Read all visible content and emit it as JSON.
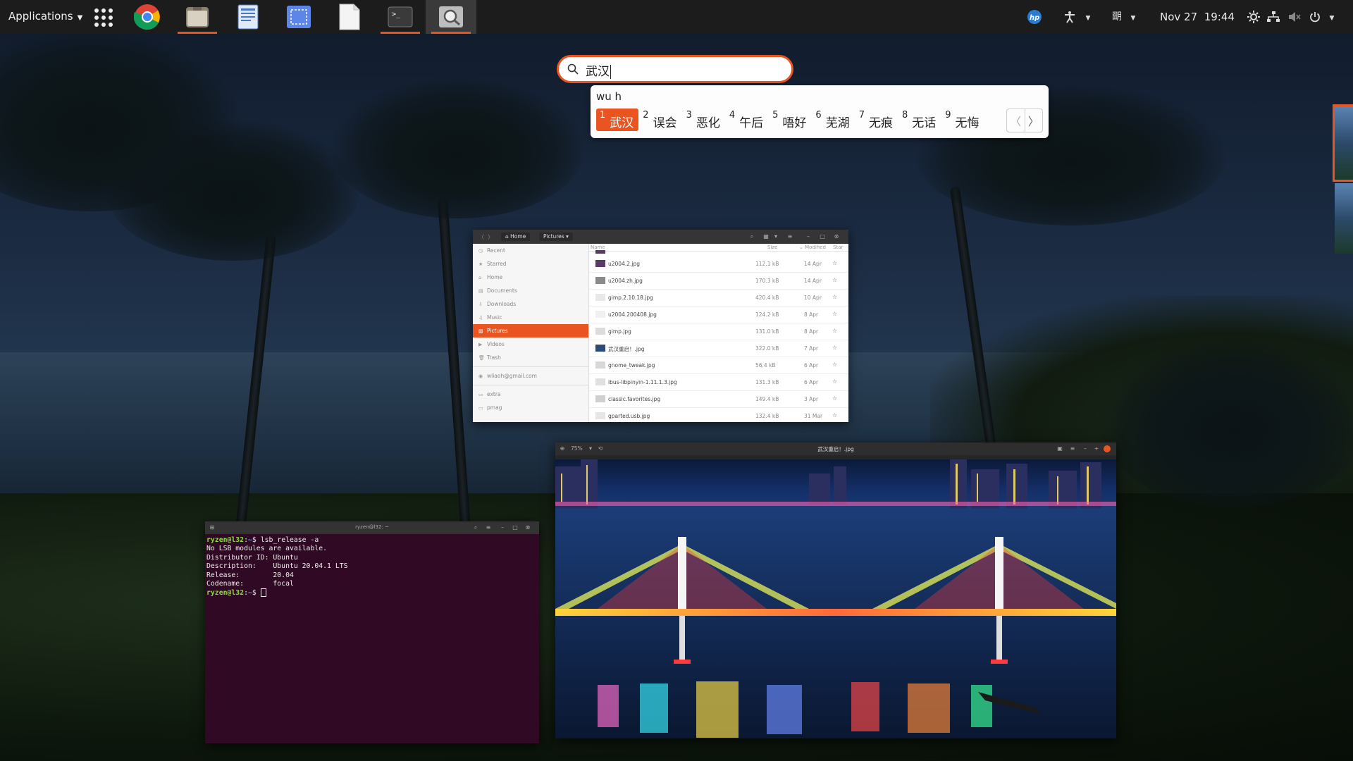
{
  "topbar": {
    "applications_label": "Applications",
    "dock": [
      {
        "name": "chrome",
        "active": false
      },
      {
        "name": "files",
        "active": true
      },
      {
        "name": "text-editor",
        "active": false
      },
      {
        "name": "screenshot",
        "active": false
      },
      {
        "name": "document",
        "active": false
      },
      {
        "name": "terminal",
        "active": true
      },
      {
        "name": "image-viewer",
        "active": true
      }
    ],
    "tray": {
      "ime_label": "朙",
      "date": "Nov 27",
      "time": "19:44"
    }
  },
  "search": {
    "value": "武汉",
    "icon": "search-icon"
  },
  "ime": {
    "preedit": "wu h",
    "candidates": [
      {
        "num": "1",
        "word": "武汉"
      },
      {
        "num": "2",
        "word": "误会"
      },
      {
        "num": "3",
        "word": "恶化"
      },
      {
        "num": "4",
        "word": "午后"
      },
      {
        "num": "5",
        "word": "唔好"
      },
      {
        "num": "6",
        "word": "芜湖"
      },
      {
        "num": "7",
        "word": "无痕"
      },
      {
        "num": "8",
        "word": "无话"
      },
      {
        "num": "9",
        "word": "无悔"
      }
    ],
    "selected_index": 0,
    "accent_color": "#e95420"
  },
  "files": {
    "breadcrumb": [
      "Home",
      "Pictures"
    ],
    "sidebar": [
      {
        "label": "Recent",
        "icon": "clock-icon"
      },
      {
        "label": "Starred",
        "icon": "star-icon"
      },
      {
        "label": "Home",
        "icon": "home-icon"
      },
      {
        "label": "Documents",
        "icon": "document-icon"
      },
      {
        "label": "Downloads",
        "icon": "download-icon"
      },
      {
        "label": "Music",
        "icon": "music-icon"
      },
      {
        "label": "Pictures",
        "icon": "picture-icon",
        "selected": true
      },
      {
        "label": "Videos",
        "icon": "video-icon"
      },
      {
        "label": "Trash",
        "icon": "trash-icon"
      },
      {
        "label": "wliaoh@gmail.com",
        "icon": "account-icon"
      },
      {
        "label": "extra",
        "icon": "folder-icon"
      },
      {
        "label": "pmag",
        "icon": "folder-icon"
      }
    ],
    "columns": {
      "name": "Name",
      "size": "Size",
      "modified": "Modified",
      "star": "Star"
    },
    "rows": [
      {
        "name": "u2004.2.jpg",
        "size": "112.1 kB",
        "modified": "14 Apr",
        "thumb": "#5a3a66"
      },
      {
        "name": "u2004.zh.jpg",
        "size": "170.3 kB",
        "modified": "14 Apr",
        "thumb": "#8a8a8a"
      },
      {
        "name": "gimp.2.10.18.jpg",
        "size": "420.4 kB",
        "modified": "10 Apr",
        "thumb": "#e8e8e8"
      },
      {
        "name": "u2004.200408.jpg",
        "size": "124.2 kB",
        "modified": "8 Apr",
        "thumb": "#f0f0f0"
      },
      {
        "name": "gimp.jpg",
        "size": "131.0 kB",
        "modified": "8 Apr",
        "thumb": "#dcdcdc"
      },
      {
        "name": "武汉重启！.jpg",
        "size": "322.0 kB",
        "modified": "7 Apr",
        "thumb": "#2c4a7a"
      },
      {
        "name": "gnome_tweak.jpg",
        "size": "56.4 kB",
        "modified": "6 Apr",
        "thumb": "#d8d8d8"
      },
      {
        "name": "ibus-libpinyin-1.11.1.3.jpg",
        "size": "131.3 kB",
        "modified": "6 Apr",
        "thumb": "#e0e0e0"
      },
      {
        "name": "classic.favorites.jpg",
        "size": "149.4 kB",
        "modified": "3 Apr",
        "thumb": "#d0d0d0"
      },
      {
        "name": "gparted.usb.jpg",
        "size": "132.4 kB",
        "modified": "31 Mar",
        "thumb": "#e6e6e6"
      }
    ]
  },
  "viewer": {
    "zoom": "75%",
    "title": "武汉重启！.jpg"
  },
  "terminal": {
    "title": "ryzen@l32: ~",
    "user": "ryzen@l32",
    "path": "~",
    "command": "lsb_release -a",
    "output": [
      "No LSB modules are available.",
      "Distributor ID: Ubuntu",
      "Description:    Ubuntu 20.04.1 LTS",
      "Release:        20.04",
      "Codename:       focal"
    ]
  }
}
